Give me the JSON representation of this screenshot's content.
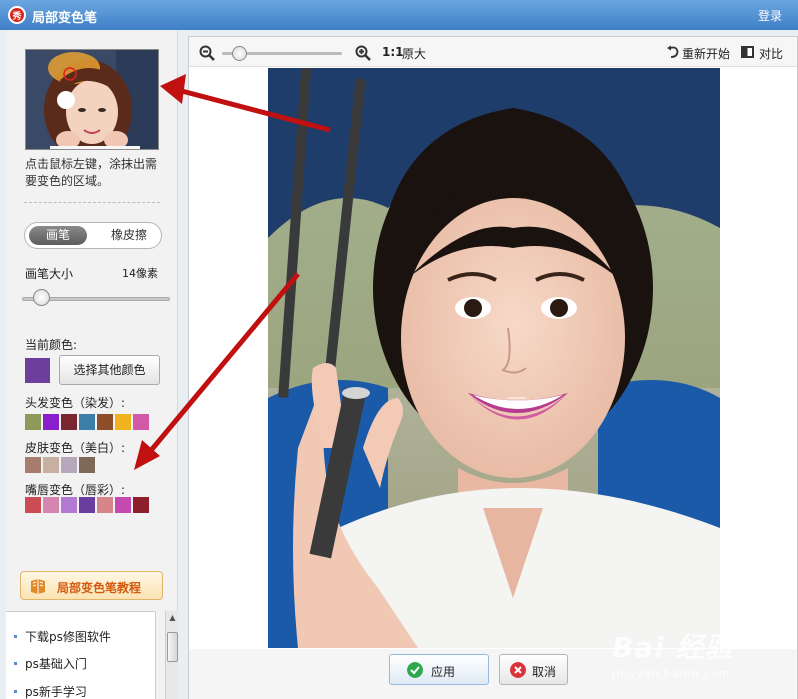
{
  "window": {
    "logo_char": "秀",
    "title": "局部变色笔",
    "login": "登录"
  },
  "left_panel": {
    "instruction": "点击鼠标左键，涂抹出需要变色的区域。",
    "tools": {
      "pen": "画笔",
      "eraser": "橡皮擦",
      "selected": "pen"
    },
    "brush": {
      "label": "画笔大小",
      "value_text": "14像素",
      "level": 0.12
    },
    "current_color": {
      "label": "当前颜色:",
      "color": "#6e3e9c"
    },
    "pick_color_button": "选择其他颜色",
    "hair": {
      "label": "头发变色（染发）:",
      "colors": [
        "#8d9a5a",
        "#8a1ecc",
        "#7a2630",
        "#3b7fa8",
        "#8e4f28",
        "#f1b220",
        "#d259a8"
      ]
    },
    "skin": {
      "label": "皮肤变色（美白）:",
      "colors": [
        "#a67d6c",
        "#c6b0a2",
        "#b6a8ba",
        "#7e6958"
      ]
    },
    "lips": {
      "label": "嘴唇变色（唇彩）:",
      "colors": [
        "#cc4c55",
        "#d684b0",
        "#b37ad4",
        "#6a3e9e",
        "#d68688",
        "#c44ab0",
        "#8e1e2a"
      ]
    },
    "tutorial_button": "局部变色笔教程",
    "links": [
      "下载ps修图软件",
      "ps基础入门",
      "ps新手学习"
    ]
  },
  "toolbar": {
    "zoom_level": 0.1,
    "original_ratio": "1:1",
    "original_label": "原大",
    "restart": "重新开始",
    "compare": "对比"
  },
  "bottom": {
    "apply": "应用",
    "cancel": "取消"
  },
  "watermark": {
    "main": "Bai 经验",
    "sub": "jingyan.baidu.com"
  },
  "colors": {
    "arrow": "#c01010",
    "titlebar": "#4a8ad2"
  }
}
